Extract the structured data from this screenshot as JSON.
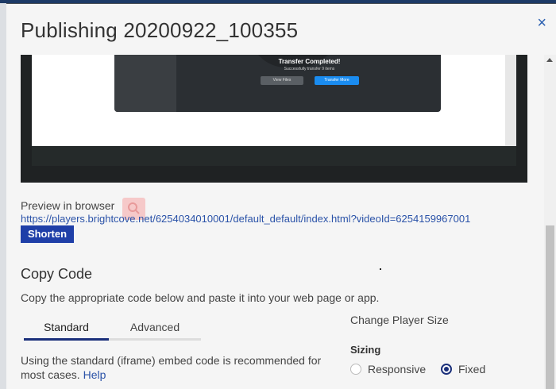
{
  "modal": {
    "title": "Publishing 20200922_100355",
    "close_glyph": "×"
  },
  "preview_thumbnail": {
    "heading": "Transfer Completed!",
    "subtext": "Successfully transfer 9 items",
    "view_button": "View Files",
    "transfer_button": "Transfer More"
  },
  "preview": {
    "label": "Preview in browser",
    "url": "https://players.brightcove.net/6254034010001/default_default/index.html?videoId=6254159967001",
    "shorten_label": "Shorten",
    "search_icon": "search-icon"
  },
  "copy_code": {
    "heading": "Copy Code",
    "description": "Copy the appropriate code below and paste it into your web page or app.",
    "tabs": [
      {
        "label": "Standard",
        "active": true
      },
      {
        "label": "Advanced",
        "active": false
      }
    ],
    "standard_text": "Using the standard (iframe) embed code is recommended for most cases.",
    "help_label": "Help"
  },
  "player_size": {
    "label": "Change Player Size",
    "sizing_label": "Sizing",
    "options": [
      {
        "label": "Responsive",
        "selected": false
      },
      {
        "label": "Fixed",
        "selected": true
      }
    ]
  },
  "colors": {
    "accent": "#1a2f7a",
    "shorten_button": "#1f3fa8",
    "link": "#2a52a8"
  }
}
